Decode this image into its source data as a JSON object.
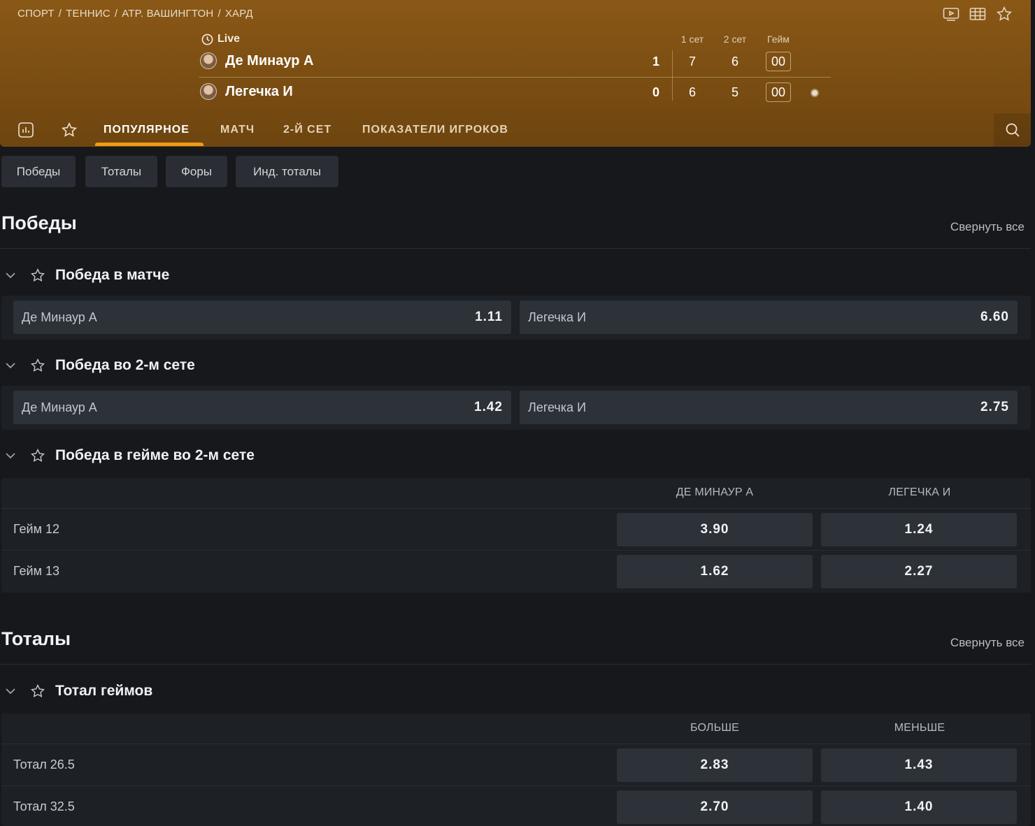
{
  "breadcrumb": [
    "СПОРТ",
    "ТЕННИС",
    "ATP. ВАШИНГТОН",
    "ХАРД"
  ],
  "header_icons": [
    "video-icon",
    "scoreboard-icon",
    "star-icon"
  ],
  "scoreboard": {
    "status": "Live",
    "columns": [
      "1 сет",
      "2 сет",
      "Гейм"
    ],
    "players": [
      {
        "name": "Де Минаур А",
        "sets": "1",
        "set1": "7",
        "set2": "6",
        "game": "00",
        "serving": false
      },
      {
        "name": "Легечка И",
        "sets": "0",
        "set1": "6",
        "set2": "5",
        "game": "00",
        "serving": true
      }
    ]
  },
  "tabs": [
    "ПОПУЛЯРНОЕ",
    "МАТЧ",
    "2-Й СЕТ",
    "ПОКАЗАТЕЛИ ИГРОКОВ"
  ],
  "active_tab": "ПОПУЛЯРНОЕ",
  "chips": [
    "Победы",
    "Тоталы",
    "Форы",
    "Инд. тоталы"
  ],
  "collapse_label": "Свернуть все",
  "sections": {
    "wins": {
      "title": "Победы",
      "markets": {
        "match": {
          "title": "Победа в матче",
          "odds": [
            {
              "label": "Де Минаур А",
              "value": "1.11"
            },
            {
              "label": "Легечка И",
              "value": "6.60"
            }
          ]
        },
        "set2": {
          "title": "Победа во 2-м сете",
          "odds": [
            {
              "label": "Де Минаур А",
              "value": "1.42"
            },
            {
              "label": "Легечка И",
              "value": "2.75"
            }
          ]
        },
        "game_set2": {
          "title": "Победа в гейме во 2-м сете",
          "columns": [
            "ДЕ МИНАУР А",
            "ЛЕГЕЧКА И"
          ],
          "rows": [
            {
              "label": "Гейм 12",
              "values": [
                "3.90",
                "1.24"
              ]
            },
            {
              "label": "Гейм 13",
              "values": [
                "1.62",
                "2.27"
              ]
            }
          ]
        }
      }
    },
    "totals": {
      "title": "Тоталы",
      "markets": {
        "games": {
          "title": "Тотал геймов",
          "columns": [
            "БОЛЬШЕ",
            "МЕНЬШЕ"
          ],
          "rows": [
            {
              "label": "Тотал 26.5",
              "values": [
                "2.83",
                "1.43"
              ]
            },
            {
              "label": "Тотал 32.5",
              "values": [
                "2.70",
                "1.40"
              ]
            }
          ]
        }
      }
    }
  },
  "colors": {
    "accent": "#f09a16",
    "header_bg": "#7a4d12",
    "page_bg": "#16181c",
    "button_bg": "#2d3138"
  }
}
